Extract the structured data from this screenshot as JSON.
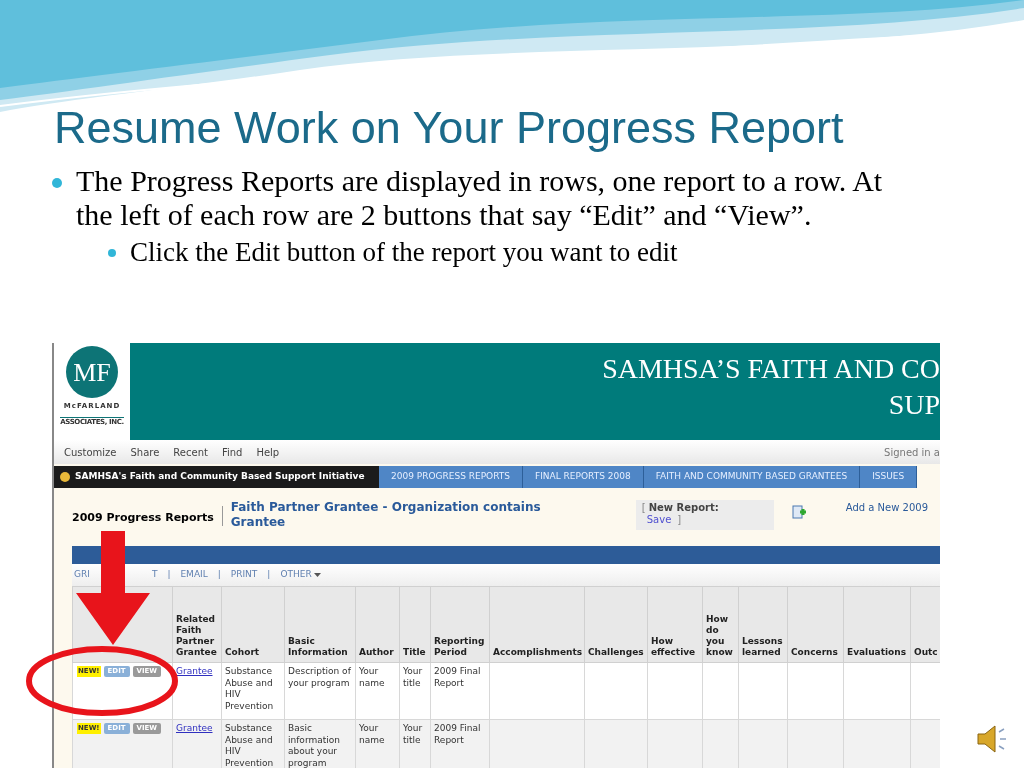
{
  "slide": {
    "title": "Resume Work on Your Progress Report",
    "bullets": [
      {
        "text": "The Progress Reports are displayed in rows, one report to a row.  At the left of each row are 2 buttons that say “Edit” and “View”.",
        "children": [
          {
            "text": "Click the Edit button of the report you want to edit"
          }
        ]
      }
    ]
  },
  "app": {
    "logo": {
      "letters": "MF",
      "name": "McFARLAND",
      "sub": "ASSOCIATES, INC."
    },
    "banner": [
      "SAMHSA’S FAITH AND CO",
      "SUP"
    ],
    "menu": [
      "Customize",
      "Share",
      "Recent",
      "Find",
      "Help"
    ],
    "signed_in": "Signed in a",
    "site": "SAMHSA's Faith and Community Based Support Initiative",
    "tabs": [
      "2009 PROGRESS REPORTS",
      "FINAL REPORTS 2008",
      "FAITH AND COMMUNITY BASED GRANTEES",
      "ISSUES"
    ],
    "page_title": "2009 Progress Reports",
    "view_title": "Faith Partner Grantee - Organization contains Grantee",
    "new_report": {
      "open": "[",
      "label": "New Report:",
      "link": "Save",
      "close": "]"
    },
    "add_new": "Add a New 2009",
    "toolbar": [
      "GRI",
      "T",
      "|",
      "EMAIL",
      "|",
      "PRINT",
      "|",
      "OTHER"
    ],
    "table": {
      "columns": [
        "Related Faith Partner Grantee",
        "Cohort",
        "Basic Information",
        "Author",
        "Title",
        "Reporting Period",
        "Accomplishments",
        "Challenges",
        "How effective",
        "How do you know",
        "Lessons learned",
        "Concerns",
        "Evaluations",
        "Outc"
      ],
      "rows": [
        {
          "badge": "NEW!",
          "edit": "EDIT",
          "view": "VIEW",
          "cells": [
            "Grantee",
            "Substance Abuse and HIV Prevention",
            "Description of your program",
            "Your name",
            "Your title",
            "2009 Final Report"
          ]
        },
        {
          "badge": "NEW!",
          "edit": "EDIT",
          "view": "VIEW",
          "cells": [
            "Grantee",
            "Substance Abuse and HIV Prevention",
            "Basic information about your program",
            "Your name",
            "Your title",
            "2009 Final Report"
          ]
        }
      ]
    }
  }
}
